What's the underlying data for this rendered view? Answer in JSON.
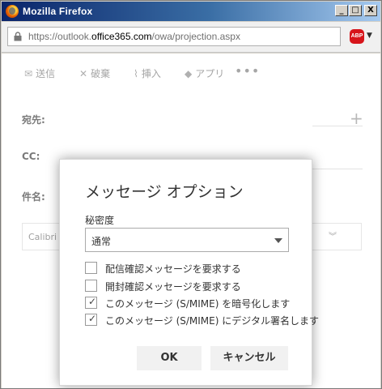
{
  "window": {
    "title": "Mozilla Firefox",
    "min": "_",
    "max": "□",
    "close": "X"
  },
  "address": {
    "prefix": "https://outlook.",
    "domain": "office365.com",
    "path": "/owa/projection.aspx"
  },
  "extension": {
    "abp_label": "ABP"
  },
  "toolbar": {
    "send": "送信",
    "discard": "破棄",
    "insert": "挿入",
    "apps": "アプリ",
    "more": "•••"
  },
  "compose": {
    "to_label": "宛先:",
    "cc_label": "CC:",
    "subject_label": "件名:",
    "font_name": "Calibri"
  },
  "dialog": {
    "title": "メッセージ オプション",
    "sensitivity_label": "秘密度",
    "sensitivity_value": "通常",
    "options": [
      {
        "label": "配信確認メッセージを要求する",
        "checked": false
      },
      {
        "label": "開封確認メッセージを要求する",
        "checked": false
      },
      {
        "label": "このメッセージ (S/MIME) を暗号化します",
        "checked": true
      },
      {
        "label": "このメッセージ (S/MIME) にデジタル署名します",
        "checked": true
      }
    ],
    "ok_label": "OK",
    "cancel_label": "キャンセル"
  }
}
